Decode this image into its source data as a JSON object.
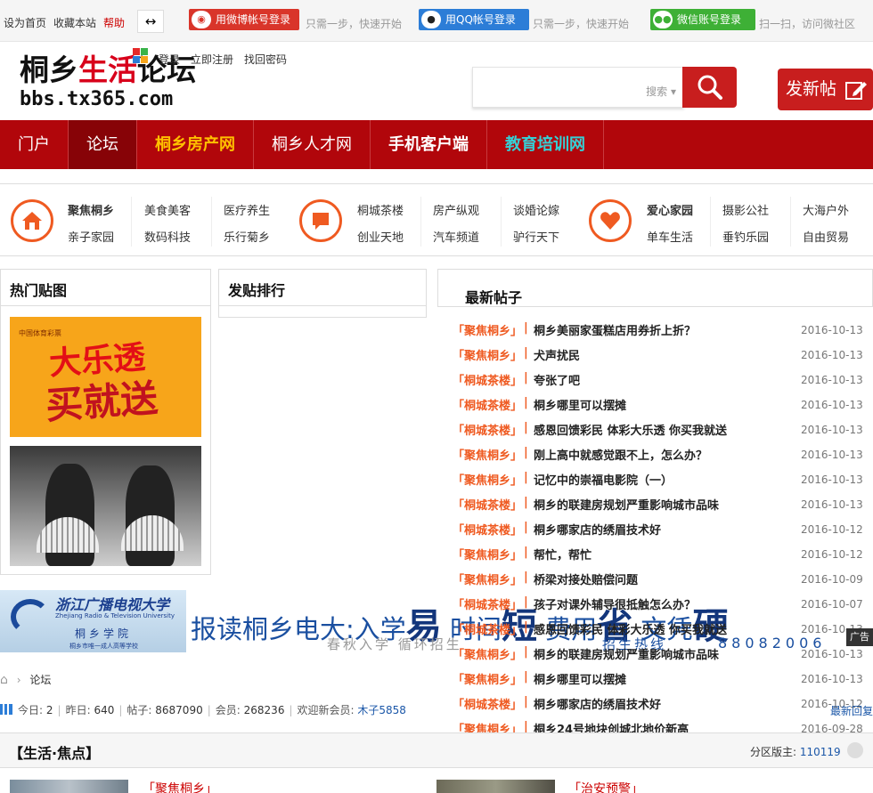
{
  "topbar": {
    "home": "设为首页",
    "fav": "收藏本站",
    "help": "帮助",
    "toggle_icon": "↔",
    "weibo_login": "用微博帐号登录",
    "weibo_hint": "只需一步，快速开始",
    "qq_login": "用QQ帐号登录",
    "qq_hint": "只需一步，快速开始",
    "wx_login": "微信账号登录",
    "wx_hint": "扫一扫，访问微社区"
  },
  "header": {
    "logo_black": "桐乡",
    "logo_red": "生活",
    "logo_black2": "论坛",
    "logo_url": "bbs.tx365.com",
    "login": "登录",
    "register": "立即注册",
    "recover": "找回密码",
    "search_placeholder": "搜索",
    "post_button": "发新帖"
  },
  "nav": [
    {
      "label": "门户"
    },
    {
      "label": "论坛"
    },
    {
      "label": "桐乡房产网"
    },
    {
      "label": "桐乡人才网"
    },
    {
      "label": "手机客户端"
    },
    {
      "label": "教育培训网"
    }
  ],
  "categories": {
    "g1": [
      "聚焦桐乡",
      "美食美客",
      "医疗养生",
      "亲子家园",
      "数码科技",
      "乐行菊乡"
    ],
    "g2": [
      "桐城茶楼",
      "房产纵观",
      "谈婚论嫁",
      "创业天地",
      "汽车频道",
      "驴行天下"
    ],
    "g3": [
      "爱心家园",
      "摄影公社",
      "大海户外",
      "单车生活",
      "垂钓乐园",
      "自由贸易"
    ]
  },
  "panels": {
    "hot": "热门贴图",
    "rank": "发贴排行",
    "latest": "最新帖子"
  },
  "hot_images": {
    "img1_tag": "中国体育彩票",
    "img1_line1": "大乐透",
    "img1_line2": "买就送"
  },
  "posts": [
    {
      "cat": "「聚焦桐乡」",
      "title": "桐乡美丽家蛋糕店用券折上折？",
      "date": "2016-10-13"
    },
    {
      "cat": "「聚焦桐乡」",
      "title": "犬声扰民",
      "date": "2016-10-13"
    },
    {
      "cat": "「桐城茶楼」",
      "title": "夸张了吧",
      "date": "2016-10-13"
    },
    {
      "cat": "「桐城茶楼」",
      "title": "桐乡哪里可以摆摊",
      "date": "2016-10-13"
    },
    {
      "cat": "「桐城茶楼」",
      "title": "感恩回馈彩民 体彩大乐透 你买我就送",
      "date": "2016-10-13"
    },
    {
      "cat": "「聚焦桐乡」",
      "title": "刚上高中就感觉跟不上，怎么办？",
      "date": "2016-10-13"
    },
    {
      "cat": "「聚焦桐乡」",
      "title": "记忆中的崇福电影院（一）",
      "date": "2016-10-13"
    },
    {
      "cat": "「桐城茶楼」",
      "title": "桐乡的联建房规划严重影响城市品味",
      "date": "2016-10-13"
    },
    {
      "cat": "「桐城茶楼」",
      "title": "桐乡哪家店的绣眉技术好",
      "date": "2016-10-12"
    },
    {
      "cat": "「聚焦桐乡」",
      "title": "帮忙，帮忙",
      "date": "2016-10-12"
    },
    {
      "cat": "「聚焦桐乡」",
      "title": "桥梁对接处赔偿问题",
      "date": "2016-10-09"
    },
    {
      "cat": "「桐城茶楼」",
      "title": "孩子对课外辅导很抵触怎么办？",
      "date": "2016-10-07"
    },
    {
      "cat": "「桐城茶楼」",
      "title": "感恩回馈彩民 体彩大乐透 你买我就送",
      "date": "2016-10-13"
    },
    {
      "cat": "「聚焦桐乡」",
      "title": "桐乡的联建房规划严重影响城市品味",
      "date": "2016-10-13"
    },
    {
      "cat": "「聚焦桐乡」",
      "title": "桐乡哪里可以摆摊",
      "date": "2016-10-13"
    },
    {
      "cat": "「桐城茶楼」",
      "title": "桐乡哪家店的绣眉技术好",
      "date": "2016-10-12"
    },
    {
      "cat": "「聚焦桐乡」",
      "title": "桐乡24号地块创城北地价新高",
      "date": "2016-09-28"
    }
  ],
  "banner": {
    "univ": "浙江广播电视大学",
    "univ_en": "Zhejiang Radio & Television University",
    "school": "桐乡学院",
    "school_sub": "桐乡市唯一成人高等学校",
    "main_pre": "报读桐乡电大:入学",
    "k1": "易",
    "m2": " 时间",
    "k2": "短",
    "m3": " 费用",
    "k3": "省",
    "m4": " 文凭",
    "k4": "硬",
    "sub1": "春秋入学 循环招生",
    "sub2": "招生热线",
    "phone": "88082006",
    "ad": "广告"
  },
  "crumb": {
    "home_icon": "⌂",
    "sep": "›",
    "label": "论坛"
  },
  "stats": {
    "today_label": "今日:",
    "today": "2",
    "yesterday_label": "昨日:",
    "yesterday": "640",
    "posts_label": "帖子:",
    "posts": "8687090",
    "members_label": "会员:",
    "members": "268236",
    "new_label": "欢迎新会员:",
    "new_member": "木子5858",
    "newreply": "最新回复"
  },
  "section": {
    "title": "【生活·焦点】",
    "mod_label": "分区版主:",
    "mod": "110119"
  },
  "bottom": {
    "cat_left": "「聚焦桐乡」",
    "cat_right": "「治安预警」"
  }
}
